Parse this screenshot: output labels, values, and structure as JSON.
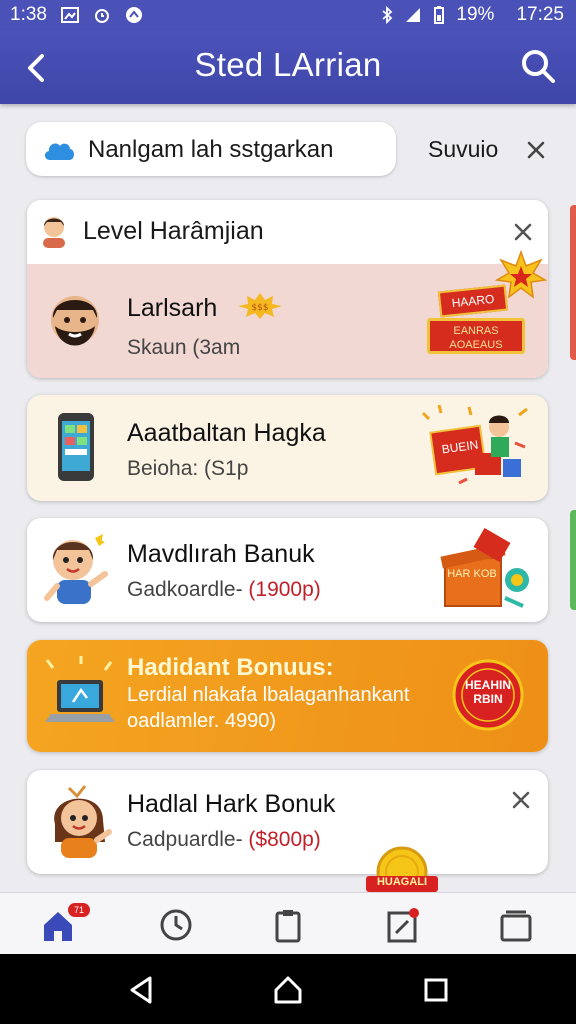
{
  "status_bar": {
    "time_left": "1:38",
    "battery": "19%",
    "time_right": "17:25"
  },
  "app_bar": {
    "title": "Sted LArrian",
    "back_icon": "chevron-left-icon",
    "search_icon": "search-icon"
  },
  "search": {
    "text": "Nanlgam lah sstgarkan",
    "filter_label": "Suvuio"
  },
  "cards": [
    {
      "header": "Level Harâmjian",
      "title": "Larlsarh",
      "subtitle": "Skaun (3am",
      "badge_top": "HAARO",
      "badge_bottom": "EANRAS AOAEAUS"
    },
    {
      "title": "Aaatbaltan Hagka",
      "subtitle": "Beioha: (S1p",
      "badge": "BUEIN"
    },
    {
      "title": "Mavdlırah Banuk",
      "subtitle_prefix": "Gadkoardle-",
      "subtitle_value": "(1900p)",
      "badge": "HAR KOB"
    },
    {
      "title": "Hadidant Bonuus:",
      "line2": "Lerdial nlakafa lbalaganhankant",
      "line3": "oadlamler. 4990)",
      "badge": "HEAHIN RBIN"
    },
    {
      "title": "Hadlal Hark Bonuk",
      "subtitle_prefix": "Cadpuardle-",
      "subtitle_value": "($800p)",
      "badge": "HUAGALI"
    }
  ],
  "nav": {
    "home_badge": "71"
  },
  "colors": {
    "primary": "#4a52b8",
    "orange": "#f29a1c",
    "pink_card": "#f1d8d3",
    "cream_card": "#fbf3e4"
  }
}
